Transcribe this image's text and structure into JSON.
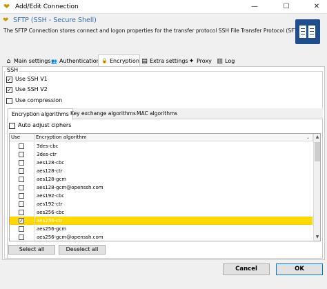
{
  "window": {
    "title": "Add/Edit Connection",
    "minimize": "—",
    "maximize": "☐",
    "close": "✕"
  },
  "header": {
    "title": "SFTP (SSH - Secure Shell)",
    "description": "The SFTP Connection stores connect and logon properties for the transfer protocol SSH File Transfer Protocol (SFTP)."
  },
  "tabs": [
    {
      "label": "Main settings",
      "icon": "house-icon",
      "glyph": "⌂"
    },
    {
      "label": "Authentication",
      "icon": "users-icon",
      "glyph": "👥"
    },
    {
      "label": "Encryption",
      "icon": "lock-icon",
      "glyph": "🔒"
    },
    {
      "label": "Extra settings",
      "icon": "list-icon",
      "glyph": "▤"
    },
    {
      "label": "Proxy",
      "icon": "proxy-icon",
      "glyph": "✦"
    },
    {
      "label": "Log",
      "icon": "log-icon",
      "glyph": "▥"
    }
  ],
  "ssh": {
    "group_label": "SSH",
    "use_v1": {
      "label": "Use SSH V1",
      "checked": true
    },
    "use_v2": {
      "label": "Use SSH V2",
      "checked": true
    },
    "use_compression": {
      "label": "Use compression",
      "checked": false
    }
  },
  "subtabs": [
    "Encryption algorithms",
    "Key exchange algorithms",
    "MAC algorithms"
  ],
  "auto_adjust": {
    "label": "Auto adjust ciphers",
    "checked": false
  },
  "grid": {
    "columns": [
      "Use",
      "Encryption algorithm"
    ],
    "rows": [
      {
        "name": "3des-cbc",
        "checked": false
      },
      {
        "name": "3des-ctr",
        "checked": false
      },
      {
        "name": "aes128-cbc",
        "checked": false
      },
      {
        "name": "aes128-ctr",
        "checked": false
      },
      {
        "name": "aes128-gcm",
        "checked": false
      },
      {
        "name": "aes128-gcm@openssh.com",
        "checked": false
      },
      {
        "name": "aes192-cbc",
        "checked": false
      },
      {
        "name": "aes192-ctr",
        "checked": false
      },
      {
        "name": "aes256-cbc",
        "checked": false
      },
      {
        "name": "aes256-ctr",
        "checked": true,
        "selected": true
      },
      {
        "name": "aes256-gcm",
        "checked": false
      },
      {
        "name": "aes256-gcm@openssh.com",
        "checked": false
      }
    ]
  },
  "buttons": {
    "select_all": "Select all",
    "deselect_all": "Deselect all",
    "cancel": "Cancel",
    "ok": "OK"
  },
  "colors": {
    "accent": "#2e6db4",
    "selection": "#ffd800",
    "doc_icon": "#1f4e8c"
  }
}
